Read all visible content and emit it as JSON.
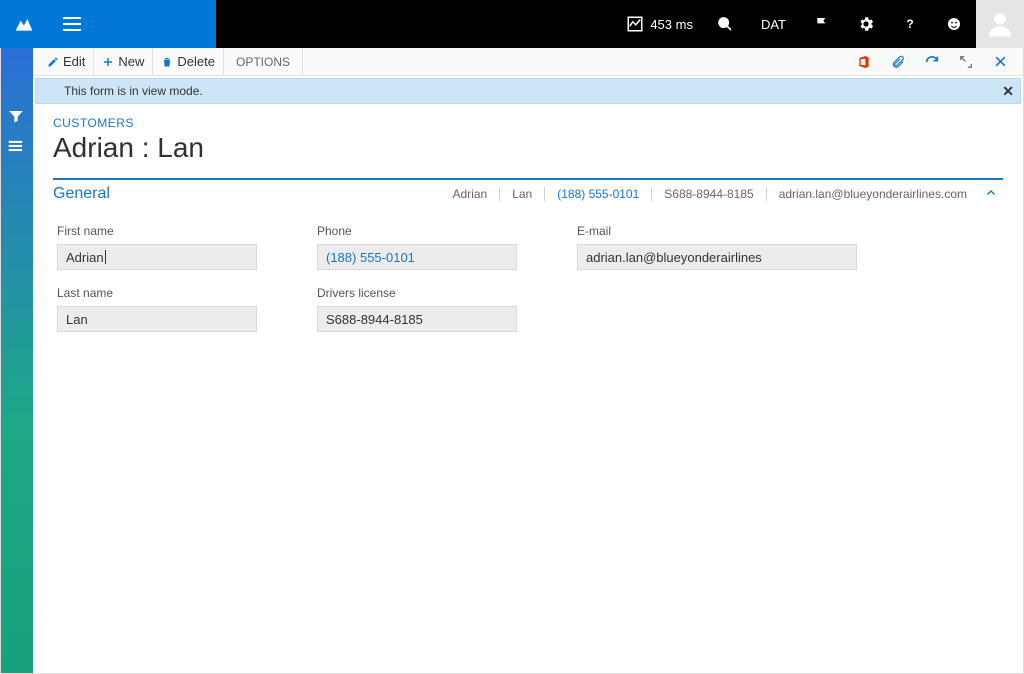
{
  "titlebar": {
    "perf_label": "453 ms",
    "company": "DAT"
  },
  "actions": {
    "edit": "Edit",
    "new": "New",
    "delete": "Delete",
    "options": "OPTIONS"
  },
  "message": "This form is in view mode.",
  "header": {
    "breadcrumb": "CUSTOMERS",
    "title": "Adrian : Lan"
  },
  "section": {
    "name": "General",
    "summary": {
      "first": "Adrian",
      "last": "Lan",
      "phone": "(188) 555-0101",
      "license": "S688-8944-8185",
      "email": "adrian.lan@blueyonderairlines.com"
    }
  },
  "fields": {
    "first_name": {
      "label": "First name",
      "value": "Adrian"
    },
    "phone": {
      "label": "Phone",
      "value": "(188) 555-0101"
    },
    "email": {
      "label": "E-mail",
      "value": "adrian.lan@blueyonderairlines"
    },
    "last_name": {
      "label": "Last name",
      "value": "Lan"
    },
    "license": {
      "label": "Drivers license",
      "value": "S688-8944-8185"
    }
  }
}
